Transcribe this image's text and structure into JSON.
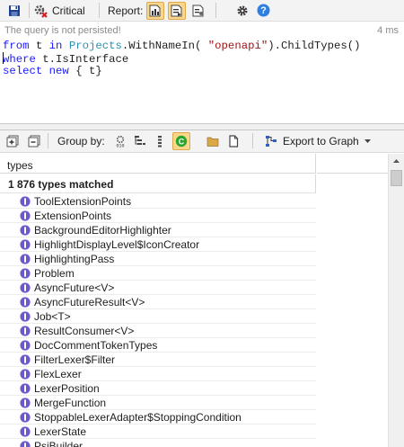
{
  "toolbar": {
    "critical_label": "Critical",
    "report_label": "Report:"
  },
  "status": {
    "message": "The query is not persisted!",
    "elapsed": "4 ms"
  },
  "query": {
    "line1": {
      "kw1": "from",
      "var": " t ",
      "kw2": "in",
      "ty": " Projects",
      "rest": ".WithNameIn( ",
      "str": "\"openapi\"",
      "end": ").ChildTypes()"
    },
    "line2": {
      "kw": "where",
      "rest": " t.IsInterface"
    },
    "line3": {
      "kw1": "select",
      "kw2": " new",
      "rest": " { t}"
    }
  },
  "results_toolbar": {
    "group_by_label": "Group by:",
    "export_label": "Export to Graph"
  },
  "grid": {
    "column_header": "types",
    "match_count": "1 876 types matched",
    "rows": [
      "ToolExtensionPoints",
      "ExtensionPoints",
      "BackgroundEditorHighlighter",
      "HighlightDisplayLevel$IconCreator",
      "HighlightingPass",
      "Problem",
      "AsyncFuture<V>",
      "AsyncFutureResult<V>",
      "Job<T>",
      "ResultConsumer<V>",
      "DocCommentTokenTypes",
      "FilterLexer$Filter",
      "FlexLexer",
      "LexerPosition",
      "MergeFunction",
      "StoppableLexerAdapter$StoppingCondition",
      "LexerState",
      "PsiBuilder"
    ]
  },
  "colors": {
    "keyword": "#1a1aff",
    "type": "#2b91af",
    "string": "#a31515",
    "active_button": "#fbd78b",
    "interface_icon": "#6a5acd"
  }
}
